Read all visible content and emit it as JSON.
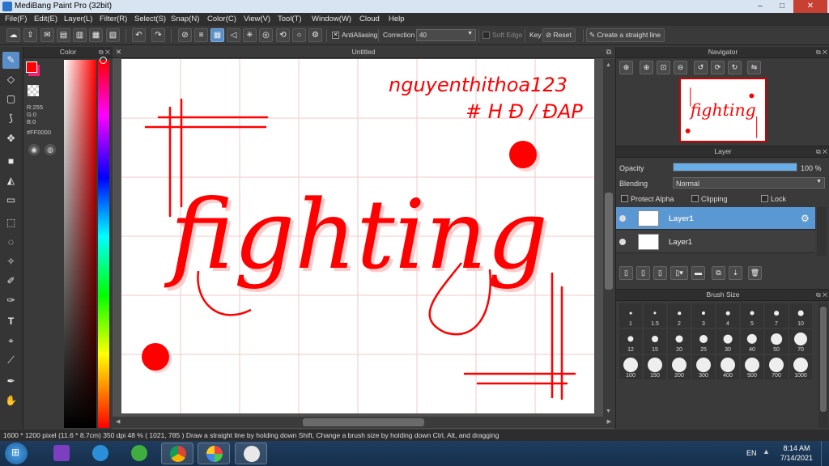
{
  "window": {
    "title": "MediBang Paint Pro (32bit)",
    "min": "–",
    "max": "□",
    "close": "✕"
  },
  "menu": [
    "File(F)",
    "Edit(E)",
    "Layer(L)",
    "Filter(R)",
    "Select(S)",
    "Snap(N)",
    "Color(C)",
    "View(V)",
    "Tool(T)",
    "Window(W)",
    "Cloud",
    "Help"
  ],
  "toolbar": {
    "antialiasing_label": "AntiAliasing",
    "correction_label": "Correction",
    "correction_value": "40",
    "soft_edge_label": "Soft Edge",
    "key_label": "Key",
    "reset_label": "Reset",
    "straight_line_label": "Create a straight line"
  },
  "color_panel": {
    "title": "Color",
    "fg_color": "#FF0000",
    "bg_color": "#FF1E6E",
    "r_label": "R:255",
    "g_label": "G:0",
    "b_label": "B:0",
    "hex_label": "#FF0000"
  },
  "canvas": {
    "tab_title": "Untitled",
    "signature_lines": [
      "nguyenthithoa123",
      "# H Đ / ĐAP"
    ],
    "main_word": "fighting",
    "ink_color": "#FF0A0A"
  },
  "navigator": {
    "title": "Navigator"
  },
  "layer_panel": {
    "title": "Layer",
    "opacity_label": "Opacity",
    "opacity_value": "100 %",
    "opacity_fraction": 1.0,
    "blending_label": "Blending",
    "blending_value": "Normal",
    "protect_alpha_label": "Protect Alpha",
    "clipping_label": "Clipping",
    "lock_label": "Lock",
    "layers": [
      {
        "name": "Layer1",
        "selected": true
      },
      {
        "name": "Layer1",
        "selected": false
      }
    ]
  },
  "brush_panel": {
    "title": "Brush Size",
    "sizes": [
      "1",
      "1.5",
      "2",
      "3",
      "4",
      "5",
      "7",
      "10",
      "12",
      "15",
      "20",
      "25",
      "30",
      "40",
      "50",
      "70",
      "100",
      "150",
      "200",
      "300",
      "400",
      "500",
      "700",
      "1000"
    ]
  },
  "status": {
    "dimensions": "1600 * 1200 pixel",
    "physical": "(11.6 * 8.7cm)",
    "dpi": "350 dpi",
    "zoom": "48 %",
    "coords": "( 1021, 785 )",
    "hint": "Draw a straight line by holding down Shift, Change a brush size by holding down Ctrl, Alt, and dragging"
  },
  "taskbar": {
    "lang": "EN",
    "time": "8:14 AM",
    "date": "7/14/2021"
  },
  "icons": [
    "cloud-icon",
    "pen-icon",
    "eraser-icon",
    "hand-icon",
    "settings-icon",
    "undo-icon",
    "redo-icon"
  ]
}
